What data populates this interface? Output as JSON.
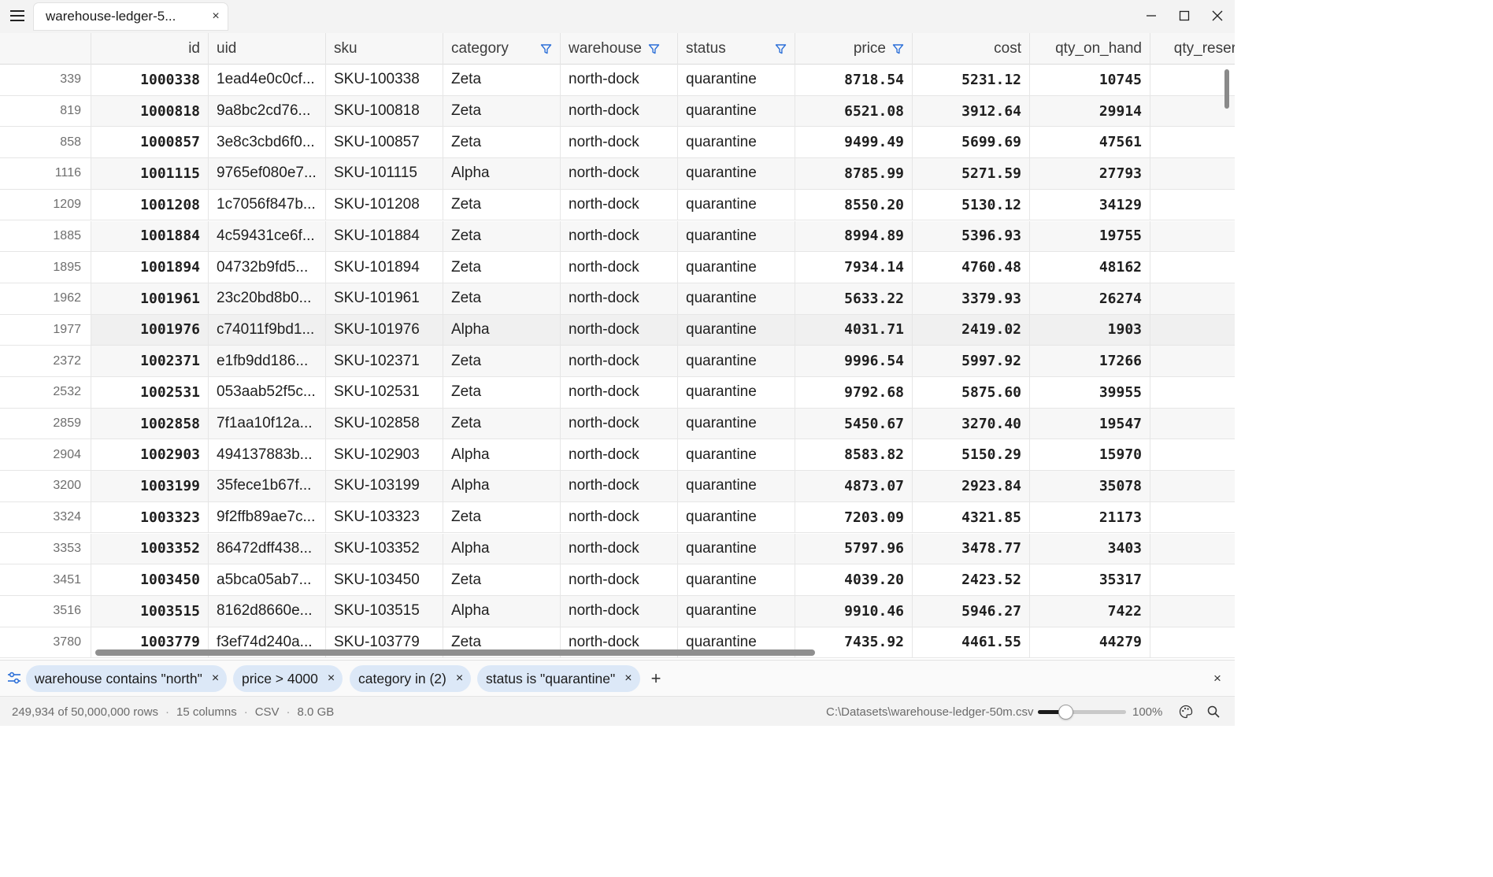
{
  "window": {
    "tab_title": "warehouse-ledger-5...",
    "tab_close": "×"
  },
  "columns": [
    {
      "key": "row",
      "label": ""
    },
    {
      "key": "id",
      "label": "id",
      "filtered": false
    },
    {
      "key": "uid",
      "label": "uid",
      "filtered": false
    },
    {
      "key": "sku",
      "label": "sku",
      "filtered": false
    },
    {
      "key": "category",
      "label": "category",
      "filtered": true
    },
    {
      "key": "warehouse",
      "label": "warehouse",
      "filtered": true
    },
    {
      "key": "status",
      "label": "status",
      "filtered": true
    },
    {
      "key": "price",
      "label": "price",
      "filtered": true
    },
    {
      "key": "cost",
      "label": "cost",
      "filtered": false
    },
    {
      "key": "qty_on_hand",
      "label": "qty_on_hand",
      "filtered": false
    },
    {
      "key": "qty_reserved",
      "label": "qty_reser",
      "filtered": false
    }
  ],
  "rows": [
    {
      "row": "339",
      "id": "1000338",
      "uid": "1ead4e0c0cf...",
      "sku": "SKU-100338",
      "category": "Zeta",
      "warehouse": "north-dock",
      "status": "quarantine",
      "price": "8718.54",
      "cost": "5231.12",
      "qty_on_hand": "10745"
    },
    {
      "row": "819",
      "id": "1000818",
      "uid": "9a8bc2cd76...",
      "sku": "SKU-100818",
      "category": "Zeta",
      "warehouse": "north-dock",
      "status": "quarantine",
      "price": "6521.08",
      "cost": "3912.64",
      "qty_on_hand": "29914"
    },
    {
      "row": "858",
      "id": "1000857",
      "uid": "3e8c3cbd6f0...",
      "sku": "SKU-100857",
      "category": "Zeta",
      "warehouse": "north-dock",
      "status": "quarantine",
      "price": "9499.49",
      "cost": "5699.69",
      "qty_on_hand": "47561"
    },
    {
      "row": "1116",
      "id": "1001115",
      "uid": "9765ef080e7...",
      "sku": "SKU-101115",
      "category": "Alpha",
      "warehouse": "north-dock",
      "status": "quarantine",
      "price": "8785.99",
      "cost": "5271.59",
      "qty_on_hand": "27793"
    },
    {
      "row": "1209",
      "id": "1001208",
      "uid": "1c7056f847b...",
      "sku": "SKU-101208",
      "category": "Zeta",
      "warehouse": "north-dock",
      "status": "quarantine",
      "price": "8550.20",
      "cost": "5130.12",
      "qty_on_hand": "34129"
    },
    {
      "row": "1885",
      "id": "1001884",
      "uid": "4c59431ce6f...",
      "sku": "SKU-101884",
      "category": "Zeta",
      "warehouse": "north-dock",
      "status": "quarantine",
      "price": "8994.89",
      "cost": "5396.93",
      "qty_on_hand": "19755"
    },
    {
      "row": "1895",
      "id": "1001894",
      "uid": "04732b9fd5...",
      "sku": "SKU-101894",
      "category": "Zeta",
      "warehouse": "north-dock",
      "status": "quarantine",
      "price": "7934.14",
      "cost": "4760.48",
      "qty_on_hand": "48162"
    },
    {
      "row": "1962",
      "id": "1001961",
      "uid": "23c20bd8b0...",
      "sku": "SKU-101961",
      "category": "Zeta",
      "warehouse": "north-dock",
      "status": "quarantine",
      "price": "5633.22",
      "cost": "3379.93",
      "qty_on_hand": "26274"
    },
    {
      "row": "1977",
      "id": "1001976",
      "uid": "c74011f9bd1...",
      "sku": "SKU-101976",
      "category": "Alpha",
      "warehouse": "north-dock",
      "status": "quarantine",
      "price": "4031.71",
      "cost": "2419.02",
      "qty_on_hand": "1903"
    },
    {
      "row": "2372",
      "id": "1002371",
      "uid": "e1fb9dd186...",
      "sku": "SKU-102371",
      "category": "Zeta",
      "warehouse": "north-dock",
      "status": "quarantine",
      "price": "9996.54",
      "cost": "5997.92",
      "qty_on_hand": "17266"
    },
    {
      "row": "2532",
      "id": "1002531",
      "uid": "053aab52f5c...",
      "sku": "SKU-102531",
      "category": "Zeta",
      "warehouse": "north-dock",
      "status": "quarantine",
      "price": "9792.68",
      "cost": "5875.60",
      "qty_on_hand": "39955"
    },
    {
      "row": "2859",
      "id": "1002858",
      "uid": "7f1aa10f12a...",
      "sku": "SKU-102858",
      "category": "Zeta",
      "warehouse": "north-dock",
      "status": "quarantine",
      "price": "5450.67",
      "cost": "3270.40",
      "qty_on_hand": "19547"
    },
    {
      "row": "2904",
      "id": "1002903",
      "uid": "494137883b...",
      "sku": "SKU-102903",
      "category": "Alpha",
      "warehouse": "north-dock",
      "status": "quarantine",
      "price": "8583.82",
      "cost": "5150.29",
      "qty_on_hand": "15970"
    },
    {
      "row": "3200",
      "id": "1003199",
      "uid": "35fece1b67f...",
      "sku": "SKU-103199",
      "category": "Alpha",
      "warehouse": "north-dock",
      "status": "quarantine",
      "price": "4873.07",
      "cost": "2923.84",
      "qty_on_hand": "35078"
    },
    {
      "row": "3324",
      "id": "1003323",
      "uid": "9f2ffb89ae7c...",
      "sku": "SKU-103323",
      "category": "Zeta",
      "warehouse": "north-dock",
      "status": "quarantine",
      "price": "7203.09",
      "cost": "4321.85",
      "qty_on_hand": "21173"
    },
    {
      "row": "3353",
      "id": "1003352",
      "uid": "86472dff438...",
      "sku": "SKU-103352",
      "category": "Alpha",
      "warehouse": "north-dock",
      "status": "quarantine",
      "price": "5797.96",
      "cost": "3478.77",
      "qty_on_hand": "3403"
    },
    {
      "row": "3451",
      "id": "1003450",
      "uid": "a5bca05ab7...",
      "sku": "SKU-103450",
      "category": "Zeta",
      "warehouse": "north-dock",
      "status": "quarantine",
      "price": "4039.20",
      "cost": "2423.52",
      "qty_on_hand": "35317"
    },
    {
      "row": "3516",
      "id": "1003515",
      "uid": "8162d8660e...",
      "sku": "SKU-103515",
      "category": "Alpha",
      "warehouse": "north-dock",
      "status": "quarantine",
      "price": "9910.46",
      "cost": "5946.27",
      "qty_on_hand": "7422"
    },
    {
      "row": "3780",
      "id": "1003779",
      "uid": "f3ef74d240a...",
      "sku": "SKU-103779",
      "category": "Zeta",
      "warehouse": "north-dock",
      "status": "quarantine",
      "price": "7435.92",
      "cost": "4461.55",
      "qty_on_hand": "44279"
    }
  ],
  "filters": [
    {
      "label": "warehouse contains \"north\"",
      "remove": "×"
    },
    {
      "label": "price > 4000",
      "remove": "×"
    },
    {
      "label": "category in (2)",
      "remove": "×"
    },
    {
      "label": "status is \"quarantine\"",
      "remove": "×"
    }
  ],
  "filterbar": {
    "add": "+",
    "clear": "×"
  },
  "status": {
    "rows": "249,934 of 50,000,000 rows",
    "columns": "15 columns",
    "format": "CSV",
    "size": "8.0 GB",
    "sep": "·",
    "path": "C:\\Datasets\\warehouse-ledger-50m.csv",
    "zoom_label": "100%",
    "zoom_fraction": 0.32
  },
  "colors": {
    "accent": "#2b6fd8",
    "chip_bg": "#dce8f7"
  },
  "icons": [
    "hamburger-menu-icon",
    "close-icon",
    "minimize-icon",
    "maximize-icon",
    "funnel-filter-icon",
    "filter-sliders-icon",
    "palette-icon",
    "search-icon"
  ]
}
